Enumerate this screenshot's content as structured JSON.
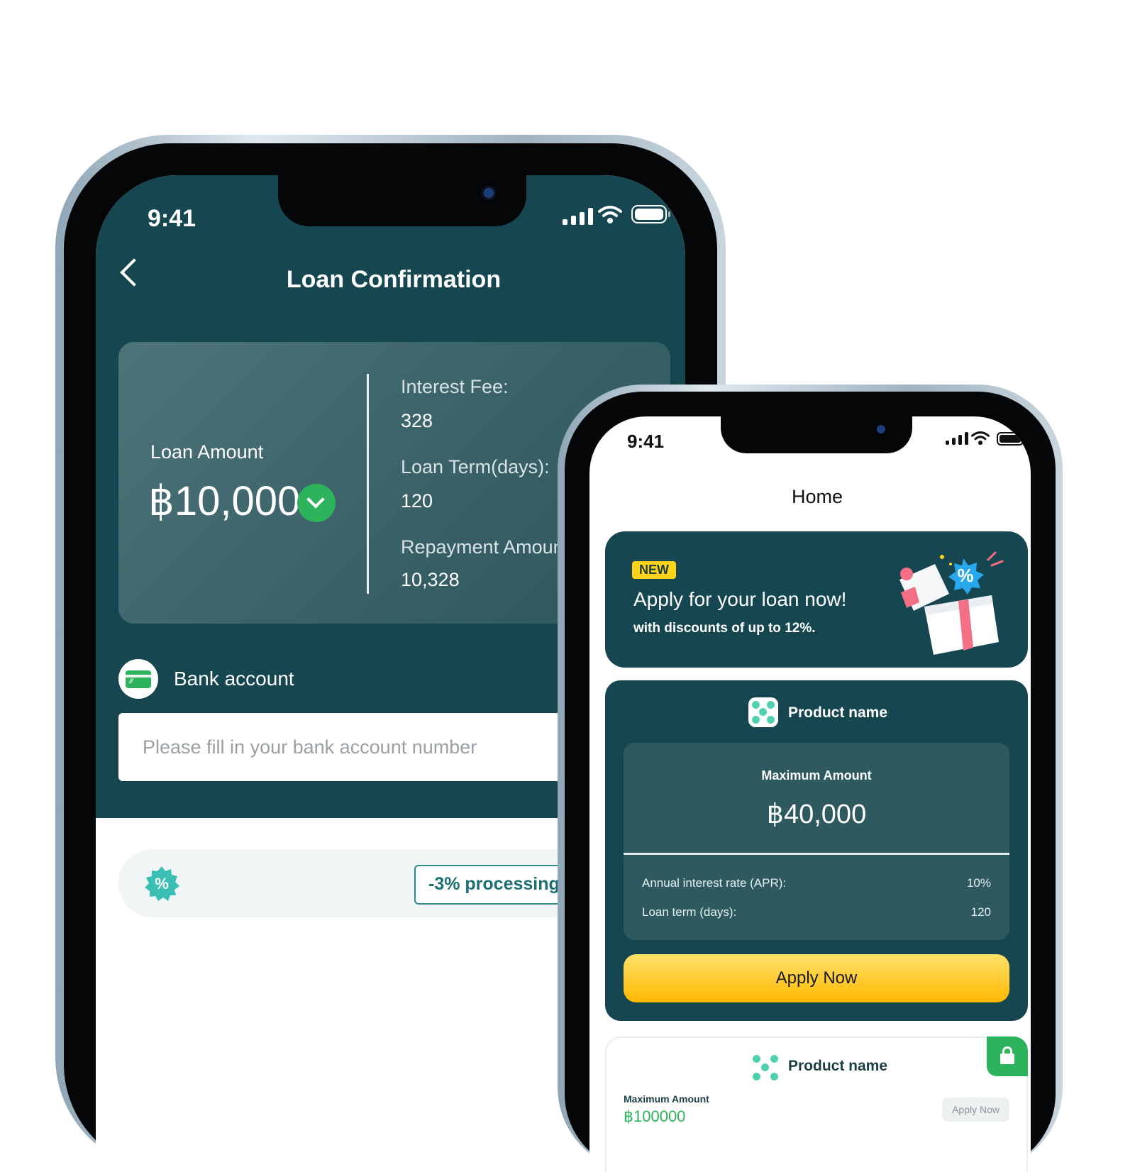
{
  "colors": {
    "brand_dark_teal": "#164750",
    "accent_green": "#2db35c",
    "apply_yellow": "#ffc21a",
    "new_badge_yellow": "#ffd319"
  },
  "confirm_screen": {
    "status_time": "9:41",
    "title": "Loan Confirmation",
    "back_icon": "chevron-left-icon",
    "loan_amount_label": "Loan Amount",
    "loan_amount_value": "฿10,000",
    "interest_fee_label": "Interest Fee:",
    "interest_fee_value": "328",
    "loan_term_label": "Loan Term(days):",
    "loan_term_value": "120",
    "repayment_label": "Repayment Amount",
    "repayment_value": "10,328",
    "bank_section_label": "Bank account",
    "bank_placeholder": "Please fill in your bank account number",
    "promo_tag": "-3% processing fee"
  },
  "home_screen": {
    "status_time": "9:41",
    "title": "Home",
    "banner": {
      "badge": "NEW",
      "title": "Apply for your loan now!",
      "subtitle": "with discounts of up to 12%."
    },
    "product1": {
      "name": "Product name",
      "max_label": "Maximum Amount",
      "max_value": "฿40,000",
      "apr_label": "Annual interest rate (APR):",
      "apr_value": "10%",
      "term_label": "Loan term (days):",
      "term_value": "120",
      "apply_label": "Apply Now"
    },
    "product2": {
      "name": "Product name",
      "max_label": "Maximum Amount",
      "max_value": "฿100000",
      "apply_label": "Apply Now"
    }
  }
}
